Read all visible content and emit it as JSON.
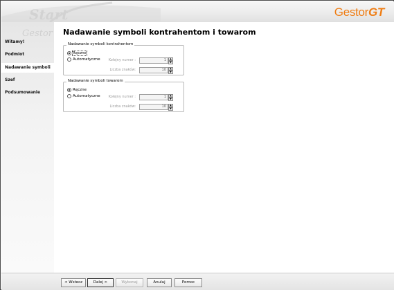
{
  "banner": {
    "brand_text": "Gestor",
    "brand_suffix": "GT",
    "ghost_text": "Start",
    "brand_color": "#ef7d14"
  },
  "sidebar": {
    "ghost_text": "Gestor",
    "items": [
      {
        "label": "Witamy!",
        "active": false
      },
      {
        "label": "Podmiot",
        "active": false
      },
      {
        "label": "Nadawanie symboli",
        "active": true
      },
      {
        "label": "Szef",
        "active": false
      },
      {
        "label": "Podsumowanie",
        "active": false
      }
    ]
  },
  "main": {
    "title": "Nadawanie symboli kontrahentom i towarom",
    "groups": [
      {
        "title": "Nadawanie symboli kontrahentom",
        "options": [
          {
            "label": "Ręczne",
            "selected": true
          },
          {
            "label": "Automatyczne",
            "selected": false
          }
        ],
        "fields": [
          {
            "label": "Kolejny numer :",
            "value": "1"
          },
          {
            "label": "Liczba znaków:",
            "value": "10"
          }
        ]
      },
      {
        "title": "Nadawanie symboli towarom",
        "options": [
          {
            "label": "Ręczne",
            "selected": true
          },
          {
            "label": "Automatyczne",
            "selected": false
          }
        ],
        "fields": [
          {
            "label": "Kolejny numer :",
            "value": "1"
          },
          {
            "label": "Liczba znaków:",
            "value": "10"
          }
        ]
      }
    ]
  },
  "buttons": {
    "back": "< Wstecz",
    "next": "Dalej >",
    "finish": "Wykonaj",
    "cancel": "Anuluj",
    "help": "Pomoc"
  }
}
